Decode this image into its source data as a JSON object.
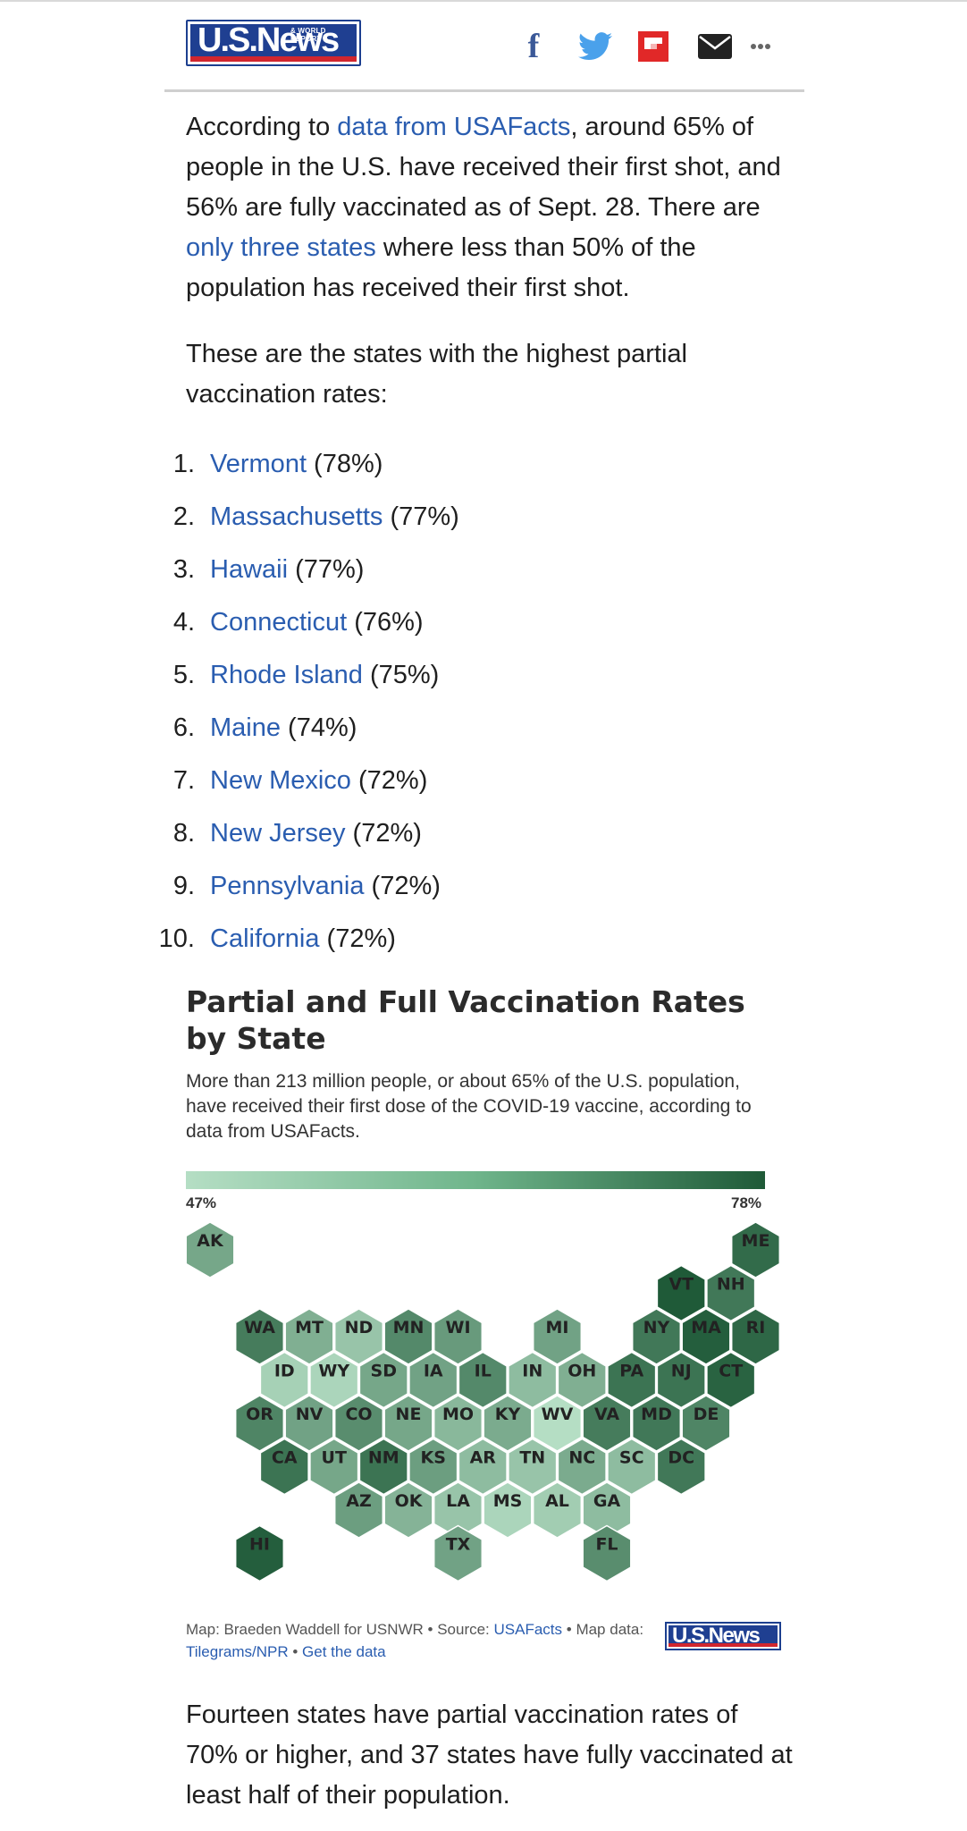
{
  "header": {
    "logo_text": "U.S.News",
    "logo_small": "& WORLD REPORT",
    "share": [
      "facebook-icon",
      "twitter-icon",
      "flipboard-icon",
      "email-icon",
      "more-icon"
    ],
    "colors": {
      "brand_blue": "#1f3f91",
      "brand_red": "#d1262e",
      "link": "#2a5db0"
    }
  },
  "intro": {
    "p1_a": "According to ",
    "p1_link1": "data from USAFacts",
    "p1_b": ", around 65% of people in the U.S. have received their first shot, and 56% are fully vaccinated as of Sept. 28. There are ",
    "p1_link2": "only three states",
    "p1_c": " where less than 50% of the population has received their first shot.",
    "p2": "These are the states with the highest partial vaccination rates:"
  },
  "top_states": [
    {
      "num": "1.",
      "name": "Vermont",
      "pct": " (78%)"
    },
    {
      "num": "2.",
      "name": "Massachusetts",
      "pct": " (77%)"
    },
    {
      "num": "3.",
      "name": "Hawaii",
      "pct": " (77%)"
    },
    {
      "num": "4.",
      "name": "Connecticut",
      "pct": " (76%)"
    },
    {
      "num": "5.",
      "name": "Rhode Island",
      "pct": " (75%)"
    },
    {
      "num": "6.",
      "name": "Maine",
      "pct": " (74%)"
    },
    {
      "num": "7.",
      "name": "New Mexico",
      "pct": " (72%)"
    },
    {
      "num": "8.",
      "name": "New Jersey",
      "pct": " (72%)"
    },
    {
      "num": "9.",
      "name": "Pennsylvania",
      "pct": " (72%)"
    },
    {
      "num": "10.",
      "name": "California",
      "pct": " (72%)"
    }
  ],
  "map": {
    "title": "Partial and Full Vaccination Rates by State",
    "subtitle": "More than 213 million people, or about 65% of the U.S. population, have received their first dose of the COVID-19 vaccine, according to data from USAFacts.",
    "legend_min": "47%",
    "legend_max": "78%",
    "credit_a": "Map: Braeden Waddell for USNWR • Source: ",
    "credit_link1": "USAFacts",
    "credit_b": " • Map data: ",
    "credit_link2": "Tilegrams/NPR",
    "credit_c": " • ",
    "credit_link3": "Get the data",
    "logo_text": "U.S.News"
  },
  "chart_data": {
    "type": "heatmap",
    "title": "Partial and Full Vaccination Rates by State",
    "scale": {
      "min": 47,
      "max": 78,
      "unit": "%",
      "low_color": "#b5dec4",
      "high_color": "#1f5a38"
    },
    "states": [
      {
        "abbr": "AK",
        "row": 0,
        "col": 0,
        "v": 60
      },
      {
        "abbr": "ME",
        "row": 0,
        "col": 11,
        "v": 74
      },
      {
        "abbr": "VT",
        "row": 1,
        "col": 9.5,
        "v": 78
      },
      {
        "abbr": "NH",
        "row": 1,
        "col": 10.5,
        "v": 71
      },
      {
        "abbr": "WA",
        "row": 2,
        "col": 1,
        "v": 70
      },
      {
        "abbr": "MT",
        "row": 2,
        "col": 2,
        "v": 58
      },
      {
        "abbr": "ND",
        "row": 2,
        "col": 3,
        "v": 53
      },
      {
        "abbr": "MN",
        "row": 2,
        "col": 4,
        "v": 67
      },
      {
        "abbr": "WI",
        "row": 2,
        "col": 5,
        "v": 63
      },
      {
        "abbr": "MI",
        "row": 2,
        "col": 7,
        "v": 61
      },
      {
        "abbr": "NY",
        "row": 2,
        "col": 9,
        "v": 71
      },
      {
        "abbr": "MA",
        "row": 2,
        "col": 10,
        "v": 77
      },
      {
        "abbr": "RI",
        "row": 2,
        "col": 11,
        "v": 75
      },
      {
        "abbr": "ID",
        "row": 3,
        "col": 1.5,
        "v": 50
      },
      {
        "abbr": "WY",
        "row": 3,
        "col": 2.5,
        "v": 49
      },
      {
        "abbr": "SD",
        "row": 3,
        "col": 3.5,
        "v": 60
      },
      {
        "abbr": "IA",
        "row": 3,
        "col": 4.5,
        "v": 61
      },
      {
        "abbr": "IL",
        "row": 3,
        "col": 5.5,
        "v": 67
      },
      {
        "abbr": "IN",
        "row": 3,
        "col": 6.5,
        "v": 55
      },
      {
        "abbr": "OH",
        "row": 3,
        "col": 7.5,
        "v": 58
      },
      {
        "abbr": "PA",
        "row": 3,
        "col": 8.5,
        "v": 72
      },
      {
        "abbr": "NJ",
        "row": 3,
        "col": 9.5,
        "v": 72
      },
      {
        "abbr": "CT",
        "row": 3,
        "col": 10.5,
        "v": 76
      },
      {
        "abbr": "OR",
        "row": 4,
        "col": 1,
        "v": 68
      },
      {
        "abbr": "NV",
        "row": 4,
        "col": 2,
        "v": 61
      },
      {
        "abbr": "CO",
        "row": 4,
        "col": 3,
        "v": 66
      },
      {
        "abbr": "NE",
        "row": 4,
        "col": 4,
        "v": 60
      },
      {
        "abbr": "MO",
        "row": 4,
        "col": 5,
        "v": 56
      },
      {
        "abbr": "KY",
        "row": 4,
        "col": 6,
        "v": 59
      },
      {
        "abbr": "WV",
        "row": 4,
        "col": 7,
        "v": 47
      },
      {
        "abbr": "VA",
        "row": 4,
        "col": 8,
        "v": 70
      },
      {
        "abbr": "MD",
        "row": 4,
        "col": 9,
        "v": 71
      },
      {
        "abbr": "DE",
        "row": 4,
        "col": 10,
        "v": 68
      },
      {
        "abbr": "CA",
        "row": 5,
        "col": 1.5,
        "v": 72
      },
      {
        "abbr": "UT",
        "row": 5,
        "col": 2.5,
        "v": 60
      },
      {
        "abbr": "NM",
        "row": 5,
        "col": 3.5,
        "v": 72
      },
      {
        "abbr": "KS",
        "row": 5,
        "col": 4.5,
        "v": 62
      },
      {
        "abbr": "AR",
        "row": 5,
        "col": 5.5,
        "v": 55
      },
      {
        "abbr": "TN",
        "row": 5,
        "col": 6.5,
        "v": 53
      },
      {
        "abbr": "NC",
        "row": 5,
        "col": 7.5,
        "v": 59
      },
      {
        "abbr": "SC",
        "row": 5,
        "col": 8.5,
        "v": 55
      },
      {
        "abbr": "DC",
        "row": 5,
        "col": 9.5,
        "v": 71
      },
      {
        "abbr": "AZ",
        "row": 6,
        "col": 3,
        "v": 62
      },
      {
        "abbr": "OK",
        "row": 6,
        "col": 4,
        "v": 57
      },
      {
        "abbr": "LA",
        "row": 6,
        "col": 5,
        "v": 53
      },
      {
        "abbr": "MS",
        "row": 6,
        "col": 6,
        "v": 49
      },
      {
        "abbr": "AL",
        "row": 6,
        "col": 7,
        "v": 51
      },
      {
        "abbr": "GA",
        "row": 6,
        "col": 8,
        "v": 55
      },
      {
        "abbr": "HI",
        "row": 7,
        "col": 1,
        "v": 77
      },
      {
        "abbr": "TX",
        "row": 7,
        "col": 5,
        "v": 61
      },
      {
        "abbr": "FL",
        "row": 7,
        "col": 8,
        "v": 66
      }
    ]
  },
  "outro": "Fourteen states have partial vaccination rates of 70% or higher, and 37 states have fully vaccinated at least half of their population."
}
